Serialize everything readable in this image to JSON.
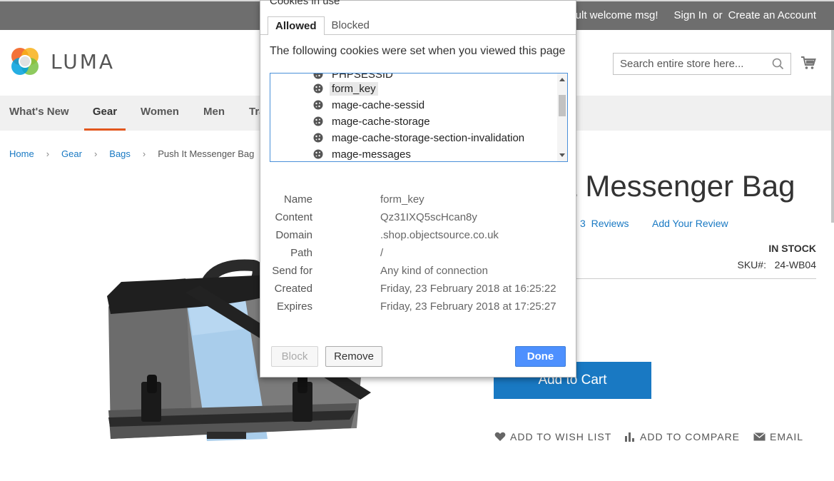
{
  "topbar": {
    "welcome": "fault welcome msg!",
    "sign_in": "Sign In",
    "or": "or",
    "create_account": "Create an Account"
  },
  "header": {
    "logo_text": "LUMA",
    "search_placeholder": "Search entire store here..."
  },
  "nav": {
    "items": [
      "What's New",
      "Gear",
      "Women",
      "Men",
      "Tra"
    ],
    "active": "Gear"
  },
  "breadcrumb": {
    "items": [
      "Home",
      "Gear",
      "Bags"
    ],
    "current": "Push It Messenger Bag"
  },
  "product": {
    "title_visible": "t Messenger Bag",
    "reviews_count": "3",
    "reviews_label": "Reviews",
    "add_review": "Add Your Review",
    "stock": "IN STOCK",
    "sku_label": "SKU#:",
    "sku_value": "24-WB04",
    "add_to_cart": "Add to Cart",
    "wishlist": "ADD TO WISH LIST",
    "compare": "ADD TO COMPARE",
    "email": "EMAIL"
  },
  "cookie_dialog": {
    "title": "Cookies in use",
    "tabs": [
      "Allowed",
      "Blocked"
    ],
    "active_tab": "Allowed",
    "description": "The following cookies were set when you viewed this page",
    "cookies": [
      "PHPSESSID",
      "form_key",
      "mage-cache-sessid",
      "mage-cache-storage",
      "mage-cache-storage-section-invalidation",
      "mage-messages"
    ],
    "selected_cookie": "form_key",
    "details": {
      "name_label": "Name",
      "name": "form_key",
      "content_label": "Content",
      "content": "Qz31IXQ5scHcan8y",
      "domain_label": "Domain",
      "domain": ".shop.objectsource.co.uk",
      "path_label": "Path",
      "path": "/",
      "sendfor_label": "Send for",
      "sendfor": "Any kind of connection",
      "created_label": "Created",
      "created": "Friday, 23 February 2018 at 16:25:22",
      "expires_label": "Expires",
      "expires": "Friday, 23 February 2018 at 17:25:27"
    },
    "buttons": {
      "block": "Block",
      "remove": "Remove",
      "done": "Done"
    }
  },
  "colors": {
    "topbar_bg": "#6e6e6e",
    "nav_bg": "#f0f0f0",
    "nav_active_underline": "#e2571e",
    "link": "#1979c3",
    "primary_button": "#1979c3",
    "done_button": "#4d90fe"
  }
}
